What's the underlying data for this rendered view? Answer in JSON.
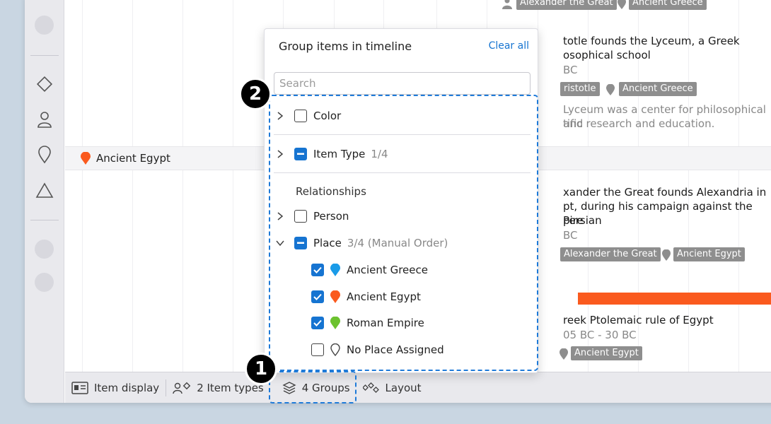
{
  "timeline": {
    "row_label": "Ancient Egypt",
    "events": [
      {
        "tags": [
          "Alexander the Great",
          "Ancient Greece"
        ]
      },
      {
        "title_lines": [
          "totle founds the Lyceum, a Greek",
          "osophical school"
        ],
        "date": "BC",
        "tags": [
          "ristotle",
          "Ancient Greece"
        ],
        "desc_lines": [
          "Lyceum was a center for philosophical and",
          "tific research and education."
        ]
      },
      {
        "title_lines": [
          "xander the Great founds Alexandria in",
          "pt, during his campaign against the Persian",
          "pire"
        ],
        "date": "BC",
        "tags": [
          "Alexander the Great",
          "Ancient Egypt"
        ]
      },
      {
        "title_lines": [
          "reek Ptolemaic rule of Egypt"
        ],
        "date": "05 BC - 30 BC",
        "tags": [
          "Ancient Egypt"
        ]
      }
    ]
  },
  "toolbar": {
    "item_display": "Item display",
    "item_types": "2 Item types",
    "groups": "4 Groups",
    "layout": "Layout"
  },
  "popover": {
    "title": "Group items in timeline",
    "clear_all": "Clear all",
    "search_placeholder": "Search",
    "color_label": "Color",
    "item_type_label": "Item Type",
    "item_type_count": "1/4",
    "relationships_label": "Relationships",
    "person_label": "Person",
    "place_label": "Place",
    "place_count": "3/4 (Manual Order)",
    "places": [
      {
        "label": "Ancient Greece",
        "checked": true,
        "color": "#1a9be8"
      },
      {
        "label": "Ancient Egypt",
        "checked": true,
        "color": "#fa5a1e"
      },
      {
        "label": "Roman Empire",
        "checked": true,
        "color": "#6cc22f"
      },
      {
        "label": "No Place Assigned",
        "checked": false,
        "color": ""
      }
    ]
  },
  "annotations": {
    "badge_1": "1",
    "badge_2": "2"
  },
  "colors": {
    "accent": "#1674d1",
    "highlight_dash": "#1e7ad8",
    "egypt_orange": "#fa5a1e"
  }
}
